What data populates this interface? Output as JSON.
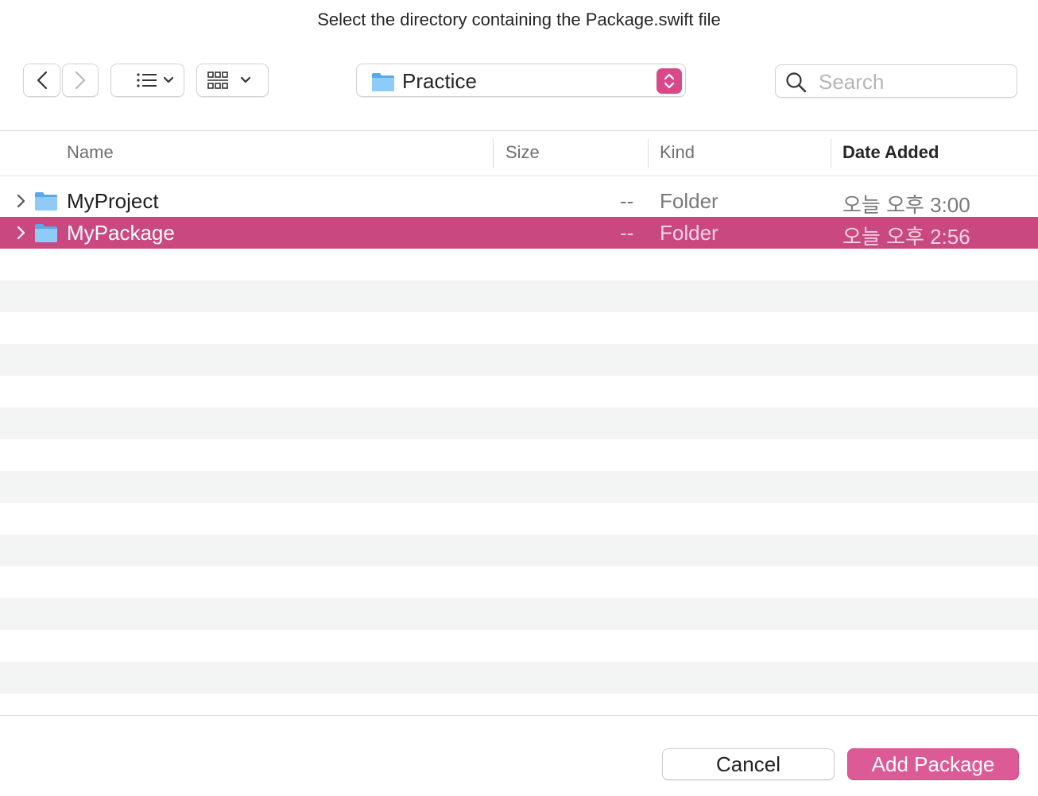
{
  "dialog": {
    "title": "Select the directory containing the Package.swift file"
  },
  "toolbar": {
    "back_icon": "chevron-left-icon",
    "forward_icon": "chevron-right-icon",
    "list_view_icon": "list-icon",
    "grid_view_icon": "grid-icon",
    "location": "Practice",
    "search_placeholder": "Search",
    "search_value": ""
  },
  "columns": {
    "name": "Name",
    "size": "Size",
    "kind": "Kind",
    "date_added": "Date Added"
  },
  "rows": [
    {
      "name": "MyProject",
      "size": "--",
      "kind": "Folder",
      "date_added": "오늘 오후 3:00",
      "selected": false
    },
    {
      "name": "MyPackage",
      "size": "--",
      "kind": "Folder",
      "date_added": "오늘 오후 2:56",
      "selected": true
    }
  ],
  "buttons": {
    "cancel": "Cancel",
    "add": "Add Package"
  },
  "colors": {
    "accent": "#dc5a95",
    "selection": "#c94880",
    "folder_blue": "#6cb6f0"
  }
}
